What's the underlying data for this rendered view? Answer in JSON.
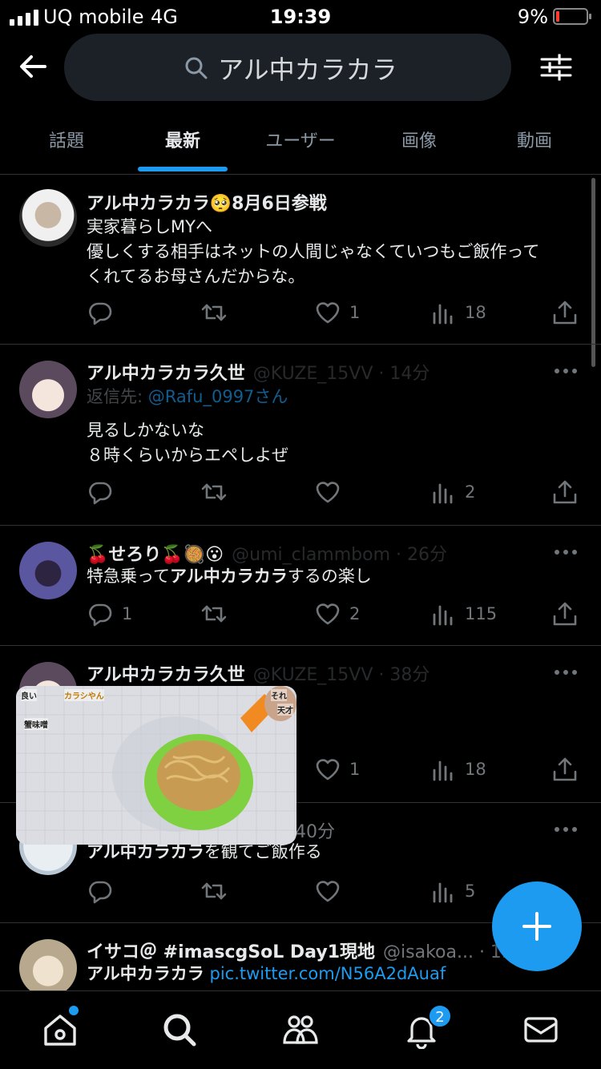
{
  "status": {
    "carrier": "UQ mobile",
    "network": "4G",
    "time": "19:39",
    "battery": "9%"
  },
  "search": {
    "query": "アル中カラカラ"
  },
  "tabs": [
    "話題",
    "最新",
    "ユーザー",
    "画像",
    "動画"
  ],
  "active_tab": "最新",
  "tweets": [
    {
      "name": "アル中カラカラ🥺8月6日参戦",
      "lines": [
        "実家暮らしMYへ",
        "優しくする相手はネットの人間じゃなくていつもご飯作って",
        "くれてるお母さんだからな。"
      ],
      "replies": "",
      "retweets": "",
      "likes": "1",
      "views": "18"
    },
    {
      "name": "アル中カラカラ久世",
      "handle": "@KUZE_15VV · 14分",
      "reply_prefix": "返信先: ",
      "reply_to": "@Rafu_0997さん",
      "lines": [
        "見るしかないな",
        "８時くらいからエペしよぜ"
      ],
      "replies": "",
      "retweets": "",
      "likes": "",
      "views": "2"
    },
    {
      "name": "🍒せろり🍒🥘😮",
      "handle": "@umi_clammbom · 26分",
      "text_bold": "アル中カラカラ",
      "text_pre": "特急乗って",
      "text_post": "するの楽し",
      "replies": "1",
      "retweets": "",
      "likes": "2",
      "views": "115"
    },
    {
      "name": "アル中カラカラ久世",
      "handle": "@KUZE_15VV · 38分",
      "replies": "",
      "retweets": "",
      "likes": "1",
      "views": "18"
    },
    {
      "time_fragment": "40分",
      "text_bold": "アル中カラカラ",
      "text_post": "を観てご飯作る",
      "replies": "",
      "retweets": "",
      "likes": "",
      "views": "5"
    },
    {
      "name": "イサコ＠ #imascgSoL Day1現地",
      "handle": "@isakoa... · 1h",
      "text_bold": "アル中カラカラ",
      "link": "pic.twitter.com/N56A2dAuaf"
    }
  ],
  "video_captions": [
    "良い",
    "カラシやん",
    "蟹味噌",
    "それ",
    "天才"
  ],
  "notification_badge": "2",
  "colors": {
    "accent": "#1d9bf0",
    "background": "#000000",
    "text": "#e7e9ea",
    "muted": "#71767b"
  }
}
